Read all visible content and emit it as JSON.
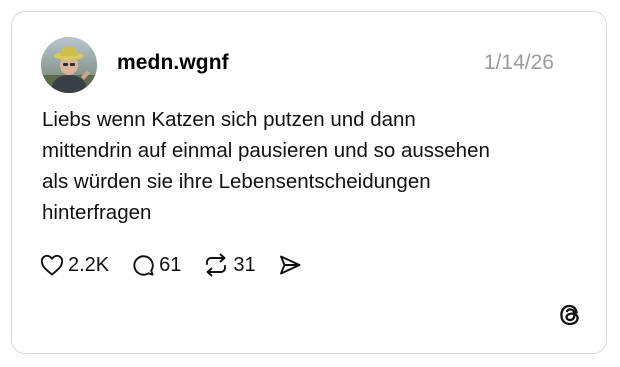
{
  "post": {
    "username": "medn.wgnf",
    "date": "1/14/26",
    "text_lines": [
      "Liebs wenn Katzen sich putzen und dann",
      "mittendrin auf einmal pausieren und so aussehen",
      "als würden sie ihre Lebensentscheidungen",
      "hinterfragen"
    ]
  },
  "actions": {
    "likes": "2.2K",
    "replies": "61",
    "reposts": "31"
  },
  "icons": {
    "like": "heart-icon",
    "reply": "comment-bubble-icon",
    "repost": "repost-arrows-icon",
    "share": "send-icon",
    "brand": "threads-logo-icon"
  }
}
